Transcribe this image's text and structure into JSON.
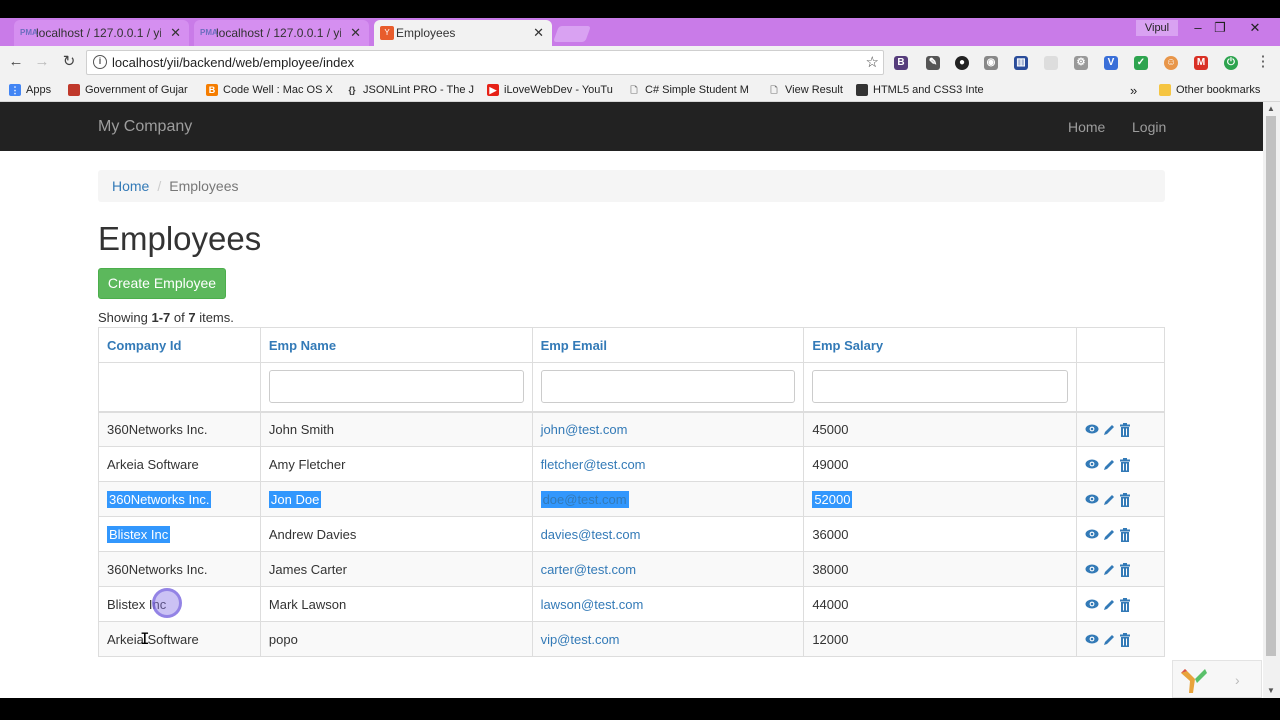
{
  "browser": {
    "tabs": [
      {
        "title": "localhost / 127.0.0.1 / yii",
        "favicon": "phpmyadmin-icon",
        "active": false
      },
      {
        "title": "localhost / 127.0.0.1 / yii",
        "favicon": "phpmyadmin-icon",
        "active": false
      },
      {
        "title": "Employees",
        "favicon": "yii-icon",
        "active": true
      }
    ],
    "user": "Vipul",
    "url": "localhost/yii/backend/web/employee/index",
    "bookmarks": [
      {
        "label": "Apps",
        "icon": "apps-grid-icon",
        "color": "#4285f4"
      },
      {
        "label": "Government of Gujar",
        "icon": "flag-icon",
        "color": "#c0392b"
      },
      {
        "label": "Code Well : Mac OS X",
        "icon": "blogger-icon",
        "color": "#f57d00"
      },
      {
        "label": "JSONLint PRO - The J",
        "icon": "braces-icon",
        "color": "#333333"
      },
      {
        "label": "iLoveWebDev - YouTu",
        "icon": "youtube-icon",
        "color": "#e62117"
      },
      {
        "label": "C# Simple Student M",
        "icon": "page-icon",
        "color": "#888888"
      },
      {
        "label": "View Result",
        "icon": "page-icon",
        "color": "#888888"
      },
      {
        "label": "HTML5 and CSS3 Inte",
        "icon": "bookmark-site-icon",
        "color": "#333333"
      }
    ],
    "other_bookmarks": "Other bookmarks",
    "overflow": "»"
  },
  "app": {
    "brand": "My Company",
    "nav": [
      {
        "label": "Home"
      },
      {
        "label": "Login"
      }
    ],
    "breadcrumb": {
      "home": "Home",
      "current": "Employees"
    },
    "title": "Employees",
    "create_button": "Create Employee",
    "summary": {
      "prefix": "Showing ",
      "range": "1-7",
      "mid": " of ",
      "total": "7",
      "suffix": " items."
    },
    "columns": [
      "Company Id",
      "Emp Name",
      "Emp Email",
      "Emp Salary"
    ],
    "rows": [
      {
        "company": "360Networks Inc.",
        "name": "John Smith",
        "email": "john@test.com",
        "salary": "45000"
      },
      {
        "company": "Arkeia Software",
        "name": "Amy Fletcher",
        "email": "fletcher@test.com",
        "salary": "49000"
      },
      {
        "company": "360Networks Inc.",
        "name": "Jon Doe",
        "email": "doe@test.com",
        "salary": "52000"
      },
      {
        "company": "Blistex Inc",
        "name": "Andrew Davies",
        "email": "davies@test.com",
        "salary": "36000"
      },
      {
        "company": "360Networks Inc.",
        "name": "James Carter",
        "email": "carter@test.com",
        "salary": "38000"
      },
      {
        "company": "Blistex Inc",
        "name": "Mark Lawson",
        "email": "lawson@test.com",
        "salary": "44000"
      },
      {
        "company": "Arkeia Software",
        "name": "popo",
        "email": "vip@test.com",
        "salary": "12000"
      }
    ],
    "row_actions": [
      "view-icon",
      "update-icon",
      "delete-icon"
    ]
  },
  "colors": {
    "navbar": "#222222",
    "link": "#337ab7",
    "success": "#5cb85c",
    "selection": "#3297fd",
    "tabstrip": "#c97be8"
  }
}
